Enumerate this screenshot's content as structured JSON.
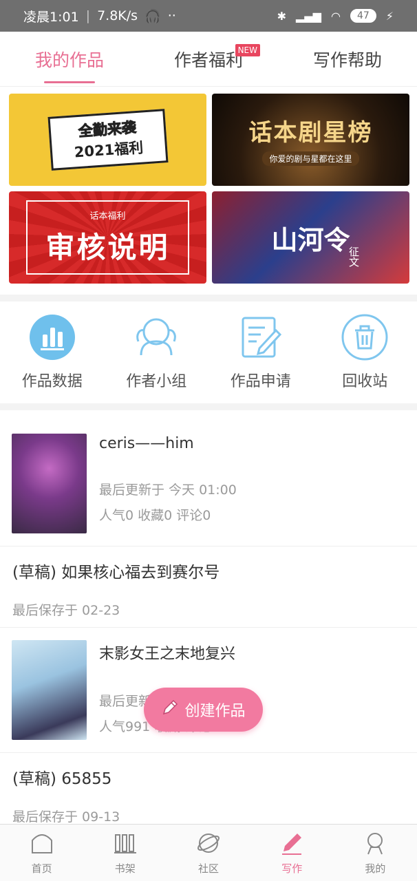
{
  "status_bar": {
    "time": "凌晨1:01",
    "speed": "7.8K/s",
    "battery": "47"
  },
  "tabs": [
    {
      "label": "我的作品",
      "active": true
    },
    {
      "label": "作者福利",
      "badge": "NEW"
    },
    {
      "label": "写作帮助"
    }
  ],
  "banners": {
    "b1_line1": "全勤来袭",
    "b1_line2": "2021福利",
    "b2_title": "话本剧星榜",
    "b2_sub": "你爱的剧与星都在这里",
    "b3_sub": "话本福利",
    "b3_main": "审核说明",
    "b4_title": "山河令",
    "b4_side": "征文"
  },
  "shortcuts": [
    {
      "label": "作品数据",
      "icon": "bar-chart-icon"
    },
    {
      "label": "作者小组",
      "icon": "group-icon"
    },
    {
      "label": "作品申请",
      "icon": "edit-document-icon"
    },
    {
      "label": "回收站",
      "icon": "trash-icon"
    }
  ],
  "works": [
    {
      "title": "ceris——him",
      "updated": "最后更新于 今天 01:00",
      "stats": "人气0 收藏0 评论0"
    },
    {
      "title": "(草稿) 如果核心福去到赛尔号",
      "saved": "最后保存于 02-23"
    },
    {
      "title": "末影女王之末地复兴",
      "updated": "最后更新于",
      "stats": "人气991 收藏 评论0"
    },
    {
      "title": "(草稿) 65855",
      "saved": "最后保存于 09-13"
    }
  ],
  "fab": {
    "label": "创建作品"
  },
  "bottom_nav": [
    {
      "label": "首页"
    },
    {
      "label": "书架"
    },
    {
      "label": "社区"
    },
    {
      "label": "写作",
      "active": true
    },
    {
      "label": "我的"
    }
  ],
  "colors": {
    "accent": "#e86f93",
    "fab": "#f27aa0",
    "icon_blue": "#5fb5e8"
  }
}
